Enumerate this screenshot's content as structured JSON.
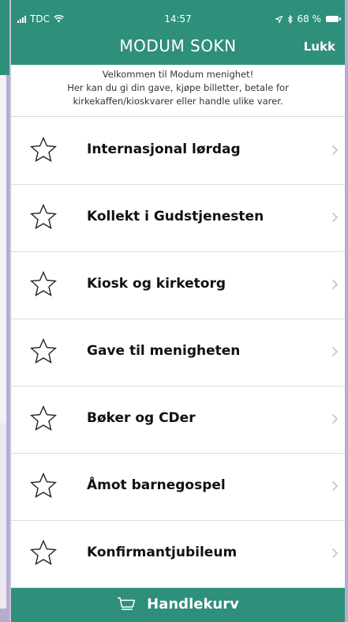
{
  "status_bar": {
    "carrier": "TDC",
    "time": "14:57",
    "battery": "68 %"
  },
  "nav": {
    "title": "MODUM SOKN",
    "close_label": "Lukk"
  },
  "welcome": {
    "lines": [
      "Velkommen til Modum menighet!",
      "Her kan du gi din gave, kjøpe billetter, betale for",
      "kirkekaffen/kioskvarer eller handle ulike varer."
    ]
  },
  "items": [
    {
      "label": "Internasjonal lørdag",
      "icon": "star-outline-icon"
    },
    {
      "label": "Kollekt i Gudstjenesten",
      "icon": "star-outline-icon"
    },
    {
      "label": "Kiosk og kirketorg",
      "icon": "star-outline-icon"
    },
    {
      "label": "Gave til menigheten",
      "icon": "star-outline-icon"
    },
    {
      "label": "Bøker og CDer",
      "icon": "star-outline-icon"
    },
    {
      "label": "Åmot barnegospel",
      "icon": "star-outline-icon"
    },
    {
      "label": "Konfirmantjubileum",
      "icon": "star-outline-icon"
    }
  ],
  "cart": {
    "label": "Handlekurv",
    "icon": "shopping-cart-icon"
  },
  "colors": {
    "brand": "#2e8f7b",
    "background_peek": "#c9bfdc"
  }
}
